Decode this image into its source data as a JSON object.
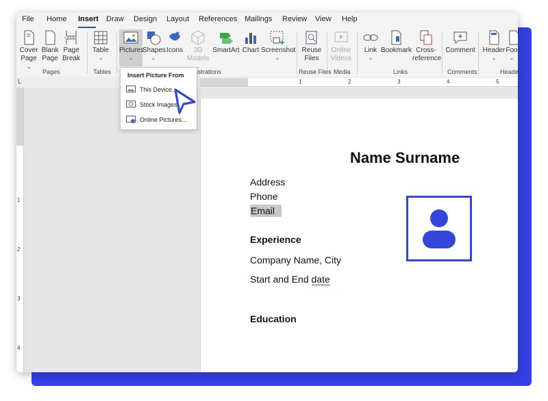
{
  "tabs": [
    "File",
    "Home",
    "Insert",
    "Draw",
    "Design",
    "Layout",
    "References",
    "Mailings",
    "Review",
    "View",
    "Help"
  ],
  "active_tab": "Insert",
  "ribbon": {
    "cover_page": [
      "Cover",
      "Page"
    ],
    "blank_page": [
      "Blank",
      "Page"
    ],
    "page_break": [
      "Page",
      "Break"
    ],
    "table": "Table",
    "pictures": "Pictures",
    "shapes": "Shapes",
    "icons": "Icons",
    "models_3d": [
      "3D",
      "Models"
    ],
    "smartart": "SmartArt",
    "chart": "Chart",
    "screenshot": "Screenshot",
    "reuse_files": [
      "Reuse",
      "Files"
    ],
    "online_videos": [
      "Online",
      "Videos"
    ],
    "link": "Link",
    "bookmark": "Bookmark",
    "cross_reference": [
      "Cross-",
      "reference"
    ],
    "comment": "Comment",
    "header": "Header",
    "footer": "Foo",
    "groups": {
      "pages": "Pages",
      "tables": "Tables",
      "illustrations": "ustrations",
      "reuse_files": "Reuse Files",
      "media": "Media",
      "links": "Links",
      "comments": "Comments",
      "header_footer": "Heade"
    }
  },
  "dropdown": {
    "header": "Insert Picture From",
    "items": [
      "This Device...",
      "Stock Images",
      "Online Pictures..."
    ]
  },
  "ruler": {
    "corner": "L",
    "h_numbers": [
      "1",
      "2",
      "3",
      "4",
      "5"
    ],
    "v_numbers": [
      "1",
      "2",
      "3",
      "4"
    ]
  },
  "document": {
    "title": "Name Surname",
    "address": "Address",
    "phone": "Phone",
    "email": "Email",
    "experience_heading": "Experience",
    "company": "Company Name, City",
    "dates_prefix": "Start and End ",
    "dates_suffix": "date",
    "education_heading": "Education"
  },
  "colors": {
    "accent": "#3446d9",
    "backdrop": "#3541e6",
    "ribbon_bg": "#f3f3f3",
    "tab_underline": "#2b579a"
  },
  "icons": [
    "cover-page-icon",
    "blank-page-icon",
    "page-break-icon",
    "table-icon",
    "pictures-icon",
    "shapes-icon",
    "icons-icon",
    "3d-models-icon",
    "smartart-icon",
    "chart-icon",
    "screenshot-icon",
    "reuse-files-icon",
    "online-videos-icon",
    "link-icon",
    "bookmark-icon",
    "cross-reference-icon",
    "comment-icon",
    "header-icon",
    "footer-icon",
    "person-placeholder-icon",
    "cursor-arrow-icon"
  ]
}
